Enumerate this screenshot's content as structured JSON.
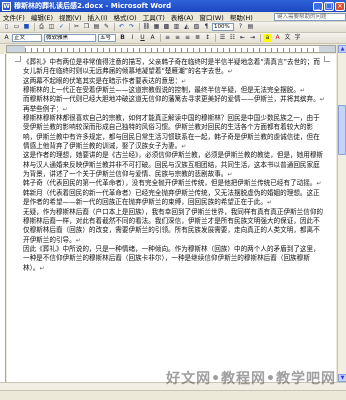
{
  "window": {
    "title": "穆斯林的葬礼读后感2.docx - Microsoft Word"
  },
  "menubar": {
    "items": [
      "文件(F)",
      "编辑(E)",
      "视图(V)",
      "插入(I)",
      "格式(O)",
      "工具(T)",
      "表格(A)",
      "窗口(W)",
      "帮助(H)"
    ],
    "help_placeholder": "键入需要帮助的问题"
  },
  "toolbar": {
    "zoom": "100%",
    "style": "正文",
    "font": "微软雅黑",
    "size": "五号"
  },
  "document": {
    "paragraphs": [
      "《葬礼》中有两位是非常值得注意的描写，父亲韩子奇在临终时是半信半疑地念着“清真言”去世的；而女儿新月在临终时则以无远弗届的倾慕地凝望着“楚雁潮”的名字去世。",
      "这两幕不起眼的伏笔其实是在暗示作者要表达的意思：",
      "穆斯林的上一代正在受着伊斯兰——这道宗教假说的控制，最终半信半疑，但是无法完全摆脱。",
      "而穆斯林的新一代则已经大胆地冲破这道无信仰的藩篱去寻求更美好的爱情——伊斯兰，并将其摈弃。",
      "再举些例子：",
      "穆斯林穆斯林都很喜欢自己的宗教，如何才能真正解读中国的穆斯林？回民是中国少数民族之一，由于受伊斯兰教的影响较深而形成自己独特的风俗习惯。伊斯兰教对回民的生活各个方面都有着较大的影响，伊斯兰教中有许多规定，都与回民日常生活习惯联系在一起，韩子奇是伊斯兰教的虔诚信徒，但在情感上他背弃了伊斯兰教的训诫，娶了汉族女子为妻。",
      "这是作者的理想，她要讲的是《古兰经》，必须信仰伊斯兰教，必须是伊斯兰教的教徒，但是，她用穆斯林与汉人通婚来反映伊斯兰教并非不可打破。回民与汉族互相团结，共同生活，这本书以普通回民家庭为背景，讲述了一个关于伊斯兰信仰与爱情、民族与宗教的悲剧故事。",
      "韩子奇（代表回民的第一代革命者），没有完全抛开伊斯兰传统，但是他把伊斯兰传统已经有了动摇。",
      "韩新月（代表着回民的新一代革命者）已经完全抛弃伊斯兰传统，又无法摆脱虚伪的婚姻的理想。这正是作者的希望——新一代的回族正在抛弃伊斯兰的束缚，回回民族的希望正在于此。",
      "无疑，作为穆斯林后裔（户口本上是回族），我有幸回到了伊斯兰世界，我同样有真有真正伊斯兰信仰的穆斯林后裔一样，对此有着截然不同的看法。我们深信，伊斯兰才是所有民族文明强大的保证，因此不仅穆斯林后裔（回族）的改变，需要伊斯兰的引领。所有民族发展需要，走向真正的人类文明，都离不开伊斯兰的引导。",
      "因此《葬礼》中所说的，只是一种情绪，一种倾向。作为穆斯林（回族）中的两个人的矛盾到了这里，一种是不信仰伊斯兰的穆斯林后裔（回族卡非尔），一种是继续信仰伊斯兰的穆斯林后裔（回族穆斯林）。"
    ]
  },
  "watermark": "好文网•教程网•教学吧网"
}
